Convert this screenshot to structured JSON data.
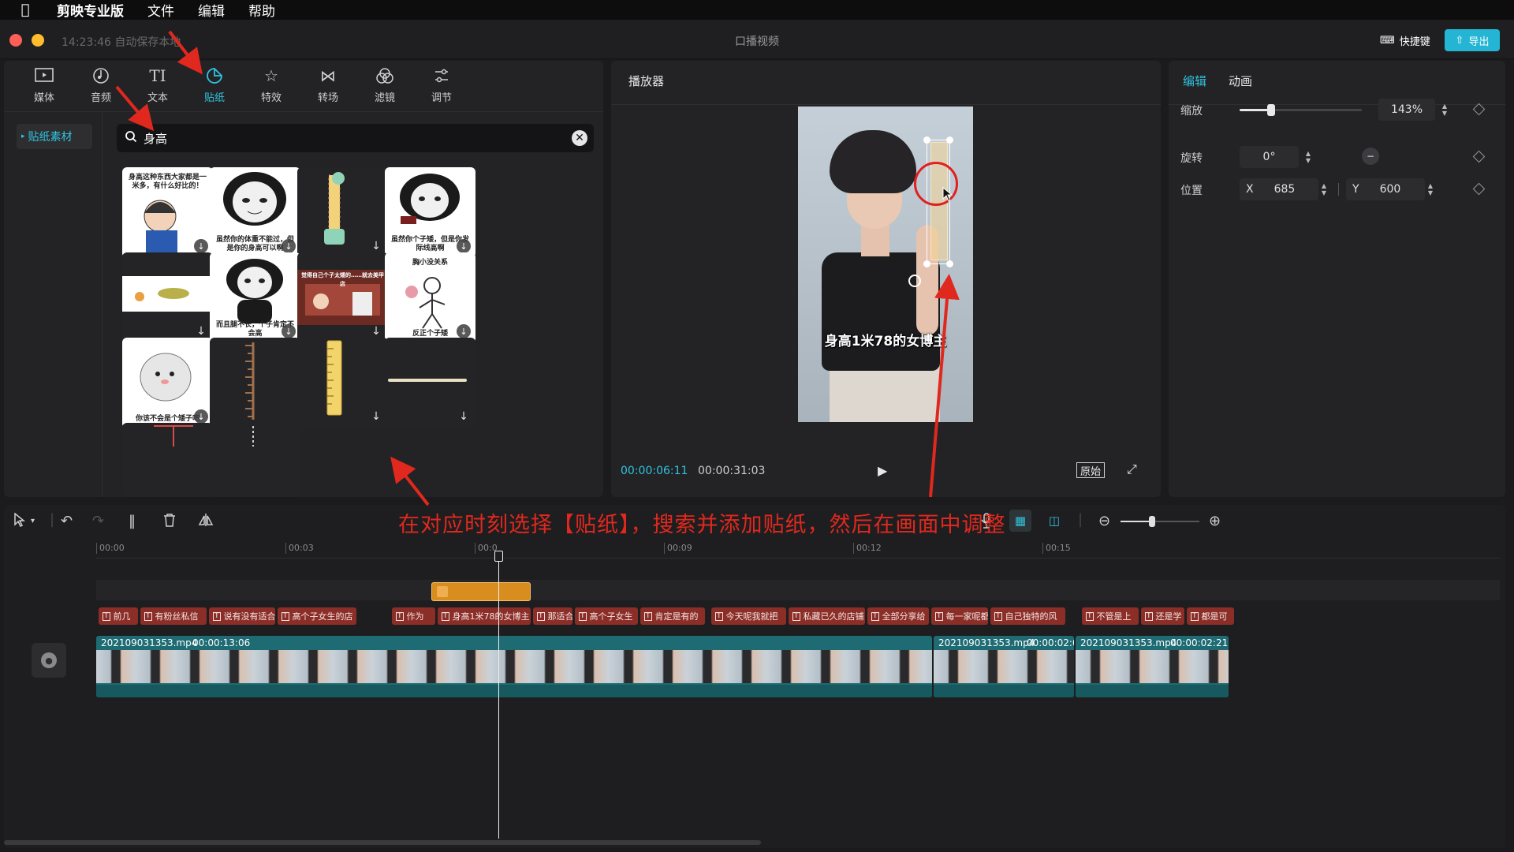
{
  "menubar": {
    "app_name": "剪映专业版",
    "items": [
      "文件",
      "编辑",
      "帮助"
    ]
  },
  "titlebar": {
    "autosave": "14:23:46 自动保存本地",
    "title": "口播视频",
    "shortcut": "快捷键",
    "export": "导出"
  },
  "media_panel": {
    "tabs": [
      {
        "label": "媒体",
        "icon": "media-icon"
      },
      {
        "label": "音频",
        "icon": "audio-icon"
      },
      {
        "label": "文本",
        "icon": "text-icon"
      },
      {
        "label": "贴纸",
        "icon": "sticker-icon",
        "active": true
      },
      {
        "label": "特效",
        "icon": "effects-icon"
      },
      {
        "label": "转场",
        "icon": "transition-icon"
      },
      {
        "label": "滤镜",
        "icon": "filter-icon"
      },
      {
        "label": "调节",
        "icon": "adjust-icon"
      }
    ],
    "sidebar_item": "贴纸素材",
    "search_value": "身高",
    "stickers": [
      {
        "caption": "身高这种东西大家都是一米多，有什么好比的！"
      },
      {
        "caption": "虽然你的体重不能过，但是你的身高可以啊"
      },
      {
        "caption": ""
      },
      {
        "caption": "虽然你个子矮，但是你发际线高啊"
      },
      {
        "caption": ""
      },
      {
        "caption": "而且腿不长，个子肯定不会高"
      },
      {
        "caption": "觉得自己个子太矮的……就去美甲店"
      },
      {
        "caption_top": "胸小没关系",
        "caption": "反正个子矮"
      },
      {
        "caption": "你该不会是个矮子吧"
      },
      {
        "caption": ""
      },
      {
        "caption": ""
      },
      {
        "caption": ""
      }
    ]
  },
  "player": {
    "title": "播放器",
    "caption": "身高1米78的女博主",
    "current_time": "00:00:06:11",
    "total_time": "00:00:31:03",
    "original_label": "原始"
  },
  "inspector": {
    "tabs": [
      "编辑",
      "动画"
    ],
    "scale_label": "缩放",
    "scale_value": "143%",
    "scale_fraction": 0.26,
    "rotate_label": "旋转",
    "rotate_value": "0°",
    "position_label": "位置",
    "x_label": "X",
    "x_value": "685",
    "y_label": "Y",
    "y_value": "600"
  },
  "timeline": {
    "ruler": [
      "00:00",
      "00:03",
      "00:0",
      "00:09",
      "00:12",
      "00:15"
    ],
    "subtitles": [
      "前几",
      "有粉丝私信",
      "说有没有适合",
      "高个子女生的店",
      "作为",
      "身高1米78的女博主",
      "那适合",
      "高个子女生",
      "肯定是有的",
      "今天呢我就把",
      "私藏已久的店铺",
      "全部分享给",
      "每一家呢都",
      "自己独特的风",
      "不管是上",
      "还是学",
      "都是可"
    ],
    "clips": [
      {
        "name": "202109031353.mp4",
        "duration": "00:00:13:06"
      },
      {
        "name": "202109031353.mp4",
        "duration": "00:00:02:0"
      },
      {
        "name": "202109031353.mp4",
        "duration": "00:00:02:21"
      }
    ]
  },
  "instruction": "在对应时刻选择【贴纸】，搜索并添加贴纸，然后在画面中调整",
  "colors": {
    "accent": "#2fc4e0",
    "sticker_clip": "#d98d1e",
    "subtitle_clip": "#8c2e28",
    "video_clip": "#1e6b73",
    "annotation_red": "#e0281e"
  }
}
